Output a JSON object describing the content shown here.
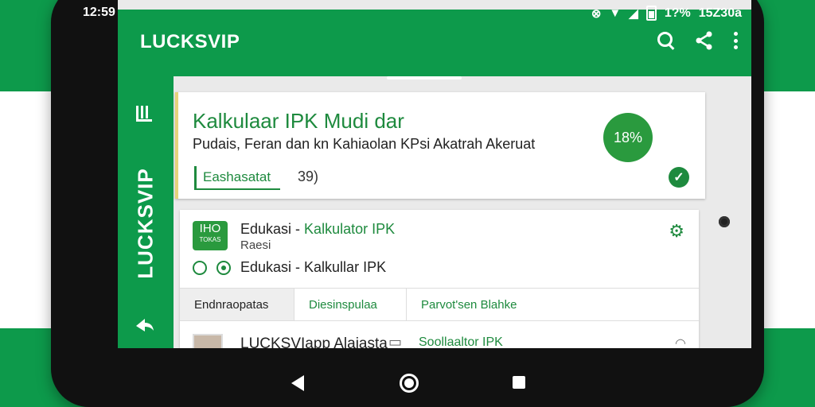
{
  "status_bar": {
    "time": "12:59",
    "battery_percent": "1?%",
    "clock_right": "15Z30a"
  },
  "app_bar": {
    "title": "LUCKSVIP",
    "icons": [
      "search-icon",
      "share-icon",
      "more-vert-icon"
    ]
  },
  "side_rail": {
    "menu_icon": "menu-icon",
    "vertical_text": "LUCKSVIP",
    "bottom_icon": "share-icon"
  },
  "card_main": {
    "title": "Kalkulaar IPK Mudi dar",
    "subtitle": "Pudais, Feran dan kn Kahiaolan KPsi Akatrah Akeruat",
    "chip_label": "Eashasatat",
    "chip_count": "39)",
    "percent": "18%"
  },
  "card_app": {
    "logo_top": "IHO",
    "logo_bottom": "TOKAS",
    "title_prefix": "Edukasi - ",
    "title_accent": "Kalkulator IPK",
    "subtitle": "Raesi",
    "option_label": "Edukasi - Kalkullar IPK",
    "tabs": [
      {
        "label": "Endnraopatas"
      },
      {
        "label": "Diesinspulaa"
      },
      {
        "label": "Parvot'sen Blahke"
      }
    ],
    "list_row": {
      "title": "LUCKSVIapp Alaiasta",
      "green": "Soollaaltor IPK"
    }
  },
  "colors": {
    "primary": "#0d9a4b",
    "accent": "#1e8a3e"
  }
}
